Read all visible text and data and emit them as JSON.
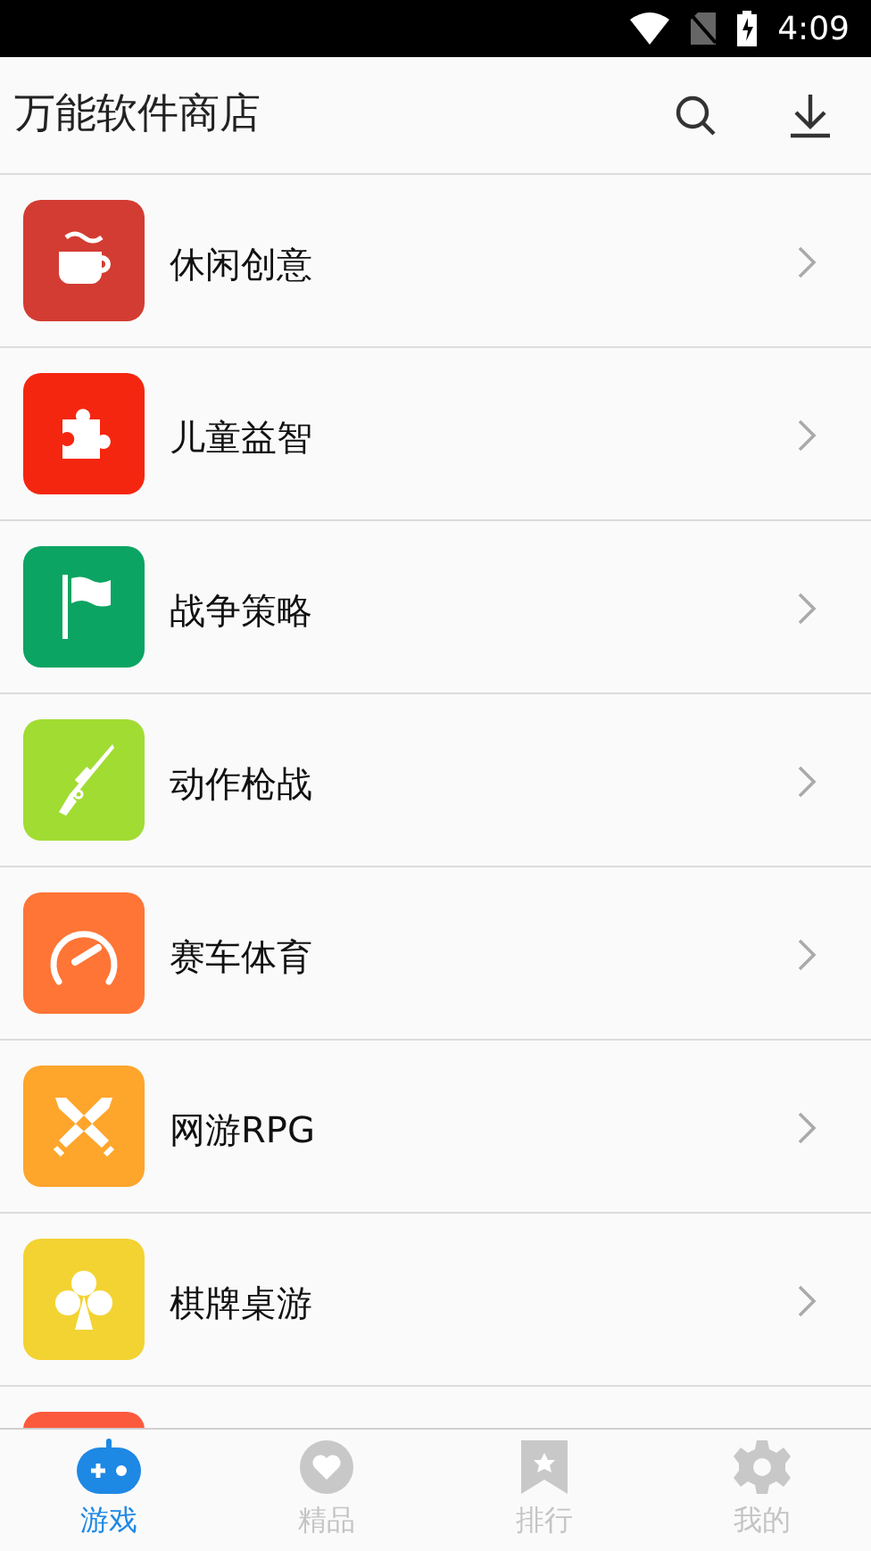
{
  "status_bar": {
    "time": "4:09"
  },
  "header": {
    "title": "万能软件商店"
  },
  "categories": [
    {
      "label": "休闲创意",
      "kind": "cup",
      "color": "#d33c32"
    },
    {
      "label": "儿童益智",
      "kind": "puzzle",
      "color": "#f5260f"
    },
    {
      "label": "战争策略",
      "kind": "flag",
      "color": "#0ba462"
    },
    {
      "label": "动作枪战",
      "kind": "rifle",
      "color": "#a1dc33"
    },
    {
      "label": "赛车体育",
      "kind": "gauge",
      "color": "#fe7536"
    },
    {
      "label": "网游RPG",
      "kind": "swords",
      "color": "#fea52c"
    },
    {
      "label": "棋牌桌游",
      "kind": "club",
      "color": "#f3d332"
    },
    {
      "kind": "partial",
      "color": "#fc5a3c"
    }
  ],
  "tabs": [
    {
      "label": "游戏",
      "kind": "gamepad",
      "selected": true
    },
    {
      "label": "精品",
      "kind": "heart",
      "selected": false
    },
    {
      "label": "排行",
      "kind": "bookmark",
      "selected": false
    },
    {
      "label": "我的",
      "kind": "gear",
      "selected": false
    }
  ]
}
